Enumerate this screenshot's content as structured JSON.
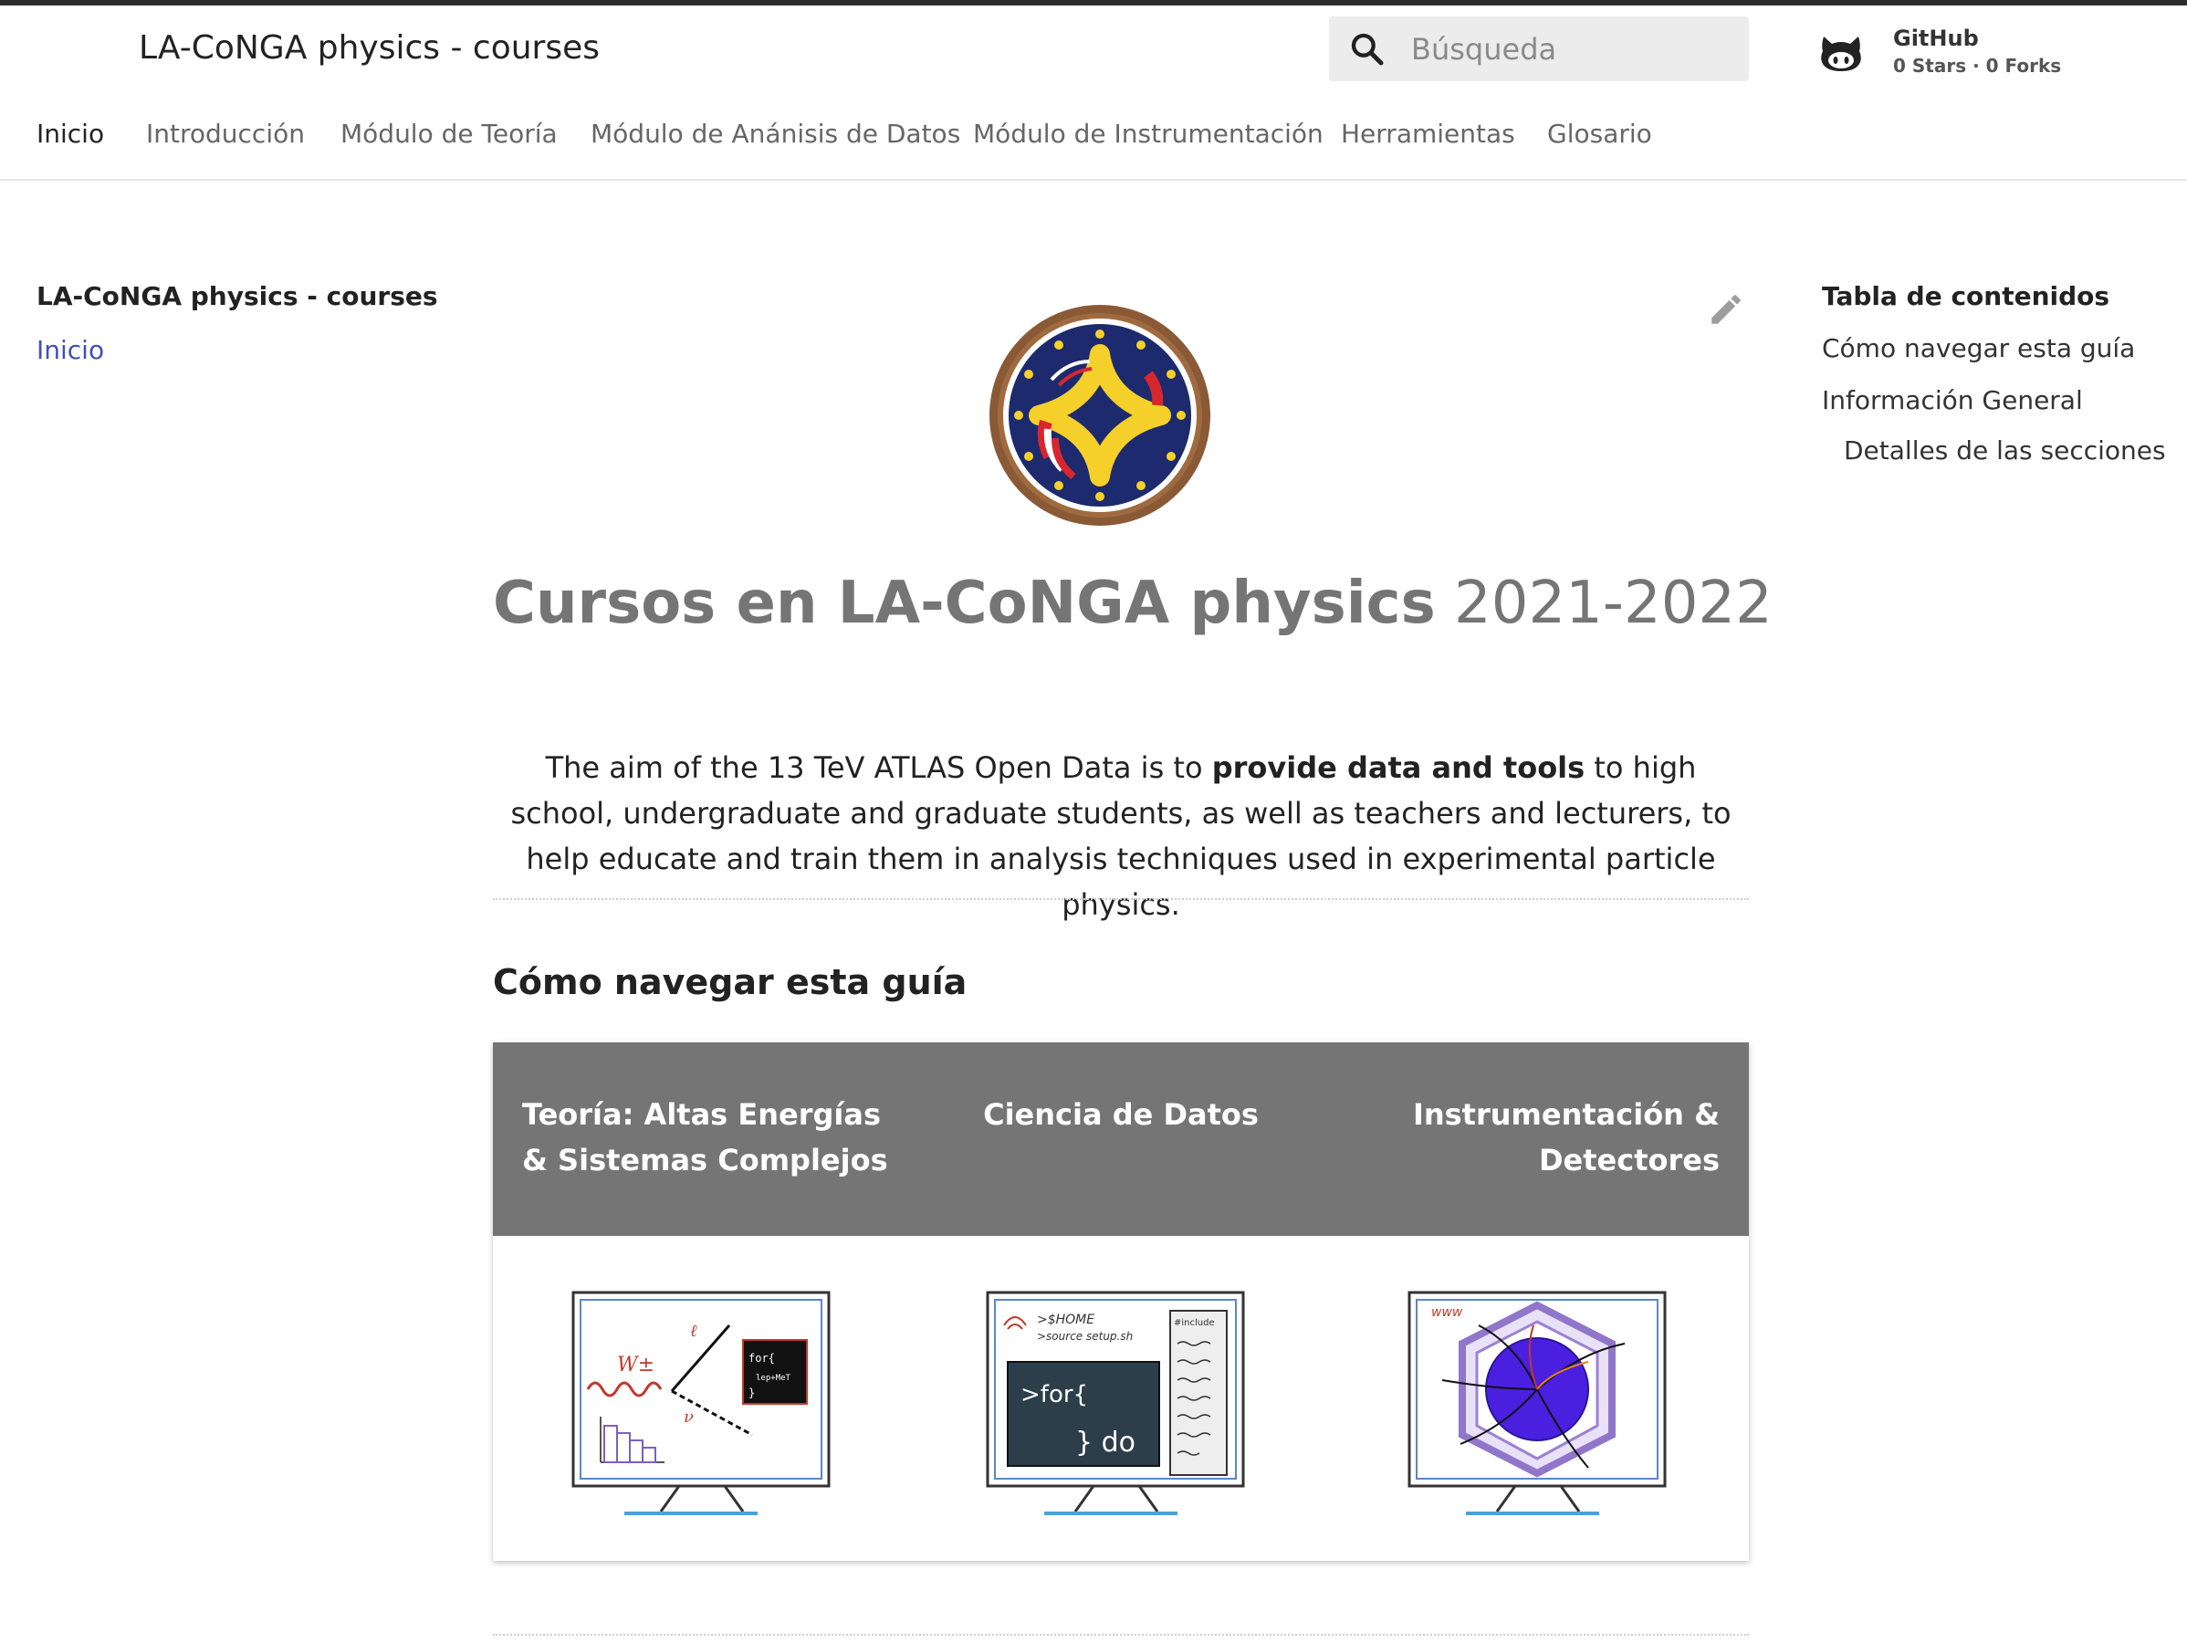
{
  "header": {
    "site_title": "LA-CoNGA physics - courses",
    "search_placeholder": "Búsqueda",
    "github": {
      "name": "GitHub",
      "stats": "0 Stars · 0 Forks"
    }
  },
  "tabs": [
    {
      "label": "Inicio",
      "active": true
    },
    {
      "label": "Introducción"
    },
    {
      "label": "Módulo de Teoría"
    },
    {
      "label": "Módulo de Anánisis de Datos"
    },
    {
      "label": "Módulo de Instrumentación"
    },
    {
      "label": "Herramientas"
    },
    {
      "label": "Glosario"
    }
  ],
  "sidebar": {
    "title": "LA-CoNGA physics - courses",
    "items": [
      {
        "label": "Inicio"
      }
    ]
  },
  "toc": {
    "title": "Tabla de contenidos",
    "items": [
      {
        "label": "Cómo navegar esta guía"
      },
      {
        "label": "Información General"
      },
      {
        "label": "Detalles de las secciones"
      }
    ]
  },
  "main": {
    "title_bold": "Cursos en LA-CoNGA physics",
    "title_light": "2021-2022",
    "intro_pre": "The aim of the 13 TeV ATLAS Open Data is to ",
    "intro_bold": "provide data and tools",
    "intro_post": " to high school, undergraduate and graduate students, as well as teachers and lecturers, to help educate and train them in analysis techniques used in experimental particle physics.",
    "section_heading": "Cómo navegar esta guía",
    "columns": [
      {
        "title": "Teoría: Altas Energías & Sistemas Complejos",
        "icon": "theory-monitor-icon"
      },
      {
        "title": "Ciencia de Datos",
        "icon": "data-science-monitor-icon"
      },
      {
        "title": "Instrumentación & Detectores",
        "icon": "detector-monitor-icon"
      }
    ],
    "monitor_texts": {
      "theory": {
        "w": "W±",
        "l": "ℓ",
        "nu": "ν",
        "code1": "for{",
        "code2": "lep+MeT",
        "code3": "}"
      },
      "data": {
        "cmd1": ">$HOME",
        "cmd2": ">source setup.sh",
        "include": "#include",
        "code1": ">for{",
        "code2": "} do"
      },
      "detector": {
        "www": "www"
      }
    }
  },
  "colors": {
    "accent": "#3f51b5",
    "header_gray": "#757575",
    "topbar": "#2d2d2d",
    "logo_navy": "#1d2a6e",
    "logo_gold": "#f5d02a",
    "logo_red": "#d8262f"
  }
}
